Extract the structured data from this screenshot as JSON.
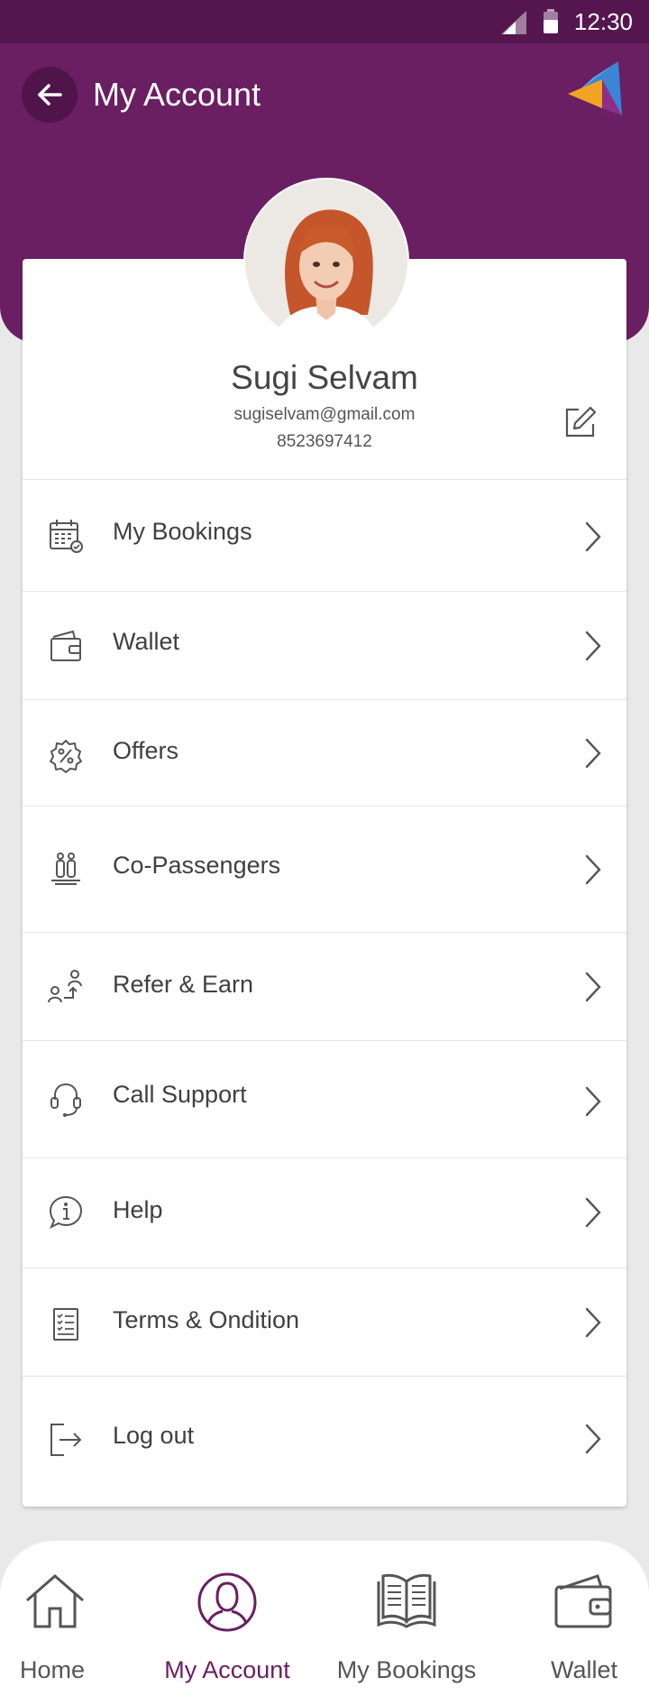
{
  "status_bar": {
    "time": "12:30"
  },
  "header": {
    "title": "My Account"
  },
  "profile": {
    "name": "Sugi Selvam",
    "email": "sugiselvam@gmail.com",
    "phone": "8523697412"
  },
  "menu": [
    {
      "label": "My Bookings",
      "icon": "calendar-icon"
    },
    {
      "label": "Wallet",
      "icon": "wallet-icon"
    },
    {
      "label": "Offers",
      "icon": "discount-badge-icon"
    },
    {
      "label": "Co-Passengers",
      "icon": "passengers-icon"
    },
    {
      "label": "Refer & Earn",
      "icon": "refer-icon"
    },
    {
      "label": "Call Support",
      "icon": "headset-icon"
    },
    {
      "label": "Help",
      "icon": "info-bubble-icon"
    },
    {
      "label": "Terms & Ondition",
      "icon": "checklist-icon"
    },
    {
      "label": "Log out",
      "icon": "logout-icon"
    }
  ],
  "bottom_nav": [
    {
      "label": "Home",
      "icon": "home-icon",
      "active": false
    },
    {
      "label": "My Account",
      "icon": "account-icon",
      "active": true
    },
    {
      "label": "My Bookings",
      "icon": "book-icon",
      "active": false
    },
    {
      "label": "Wallet",
      "icon": "wallet-icon",
      "active": false
    }
  ],
  "colors": {
    "brand_purple": "#6a1f62",
    "status_bar": "#55164f",
    "background": "#e9e9e9"
  }
}
